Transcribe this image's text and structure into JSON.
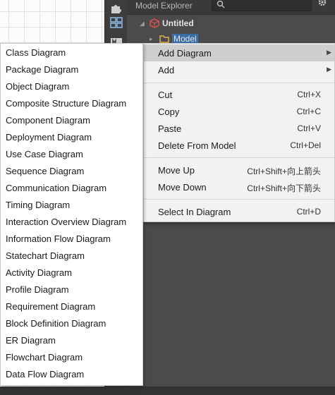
{
  "explorer": {
    "title": "Model Explorer",
    "tree": [
      {
        "label": "Untitled"
      },
      {
        "label": "Model"
      }
    ]
  },
  "context_menu": {
    "items": [
      {
        "label": "Add Diagram",
        "shortcut": "",
        "submenu": true,
        "active": true
      },
      {
        "label": "Add",
        "shortcut": "",
        "submenu": true
      },
      {
        "label": "Cut",
        "shortcut": "Ctrl+X"
      },
      {
        "label": "Copy",
        "shortcut": "Ctrl+C"
      },
      {
        "label": "Paste",
        "shortcut": "Ctrl+V"
      },
      {
        "label": "Delete From Model",
        "shortcut": "Ctrl+Del"
      },
      {
        "label": "Move Up",
        "shortcut": "Ctrl+Shift+向上箭头"
      },
      {
        "label": "Move Down",
        "shortcut": "Ctrl+Shift+向下箭头"
      },
      {
        "label": "Select In Diagram",
        "shortcut": "Ctrl+D"
      }
    ]
  },
  "submenu": {
    "items": [
      "Class Diagram",
      "Package Diagram",
      "Object Diagram",
      "Composite Structure Diagram",
      "Component Diagram",
      "Deployment Diagram",
      "Use Case Diagram",
      "Sequence Diagram",
      "Communication Diagram",
      "Timing Diagram",
      "Interaction Overview Diagram",
      "Information Flow Diagram",
      "Statechart Diagram",
      "Activity Diagram",
      "Profile Diagram",
      "Requirement Diagram",
      "Block Definition Diagram",
      "ER Diagram",
      "Flowchart Diagram",
      "Data Flow Diagram"
    ]
  },
  "colors": {
    "panel_dark": "#4b4b4b",
    "menu_bg": "#f2f2f2",
    "menu_active": "#cfcfcf",
    "model_icon_red": "#d63c3c",
    "folder_yellow": "#d9b24a"
  }
}
